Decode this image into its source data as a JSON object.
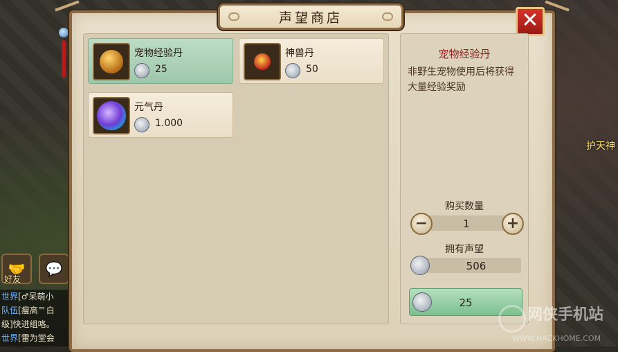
{
  "dialog": {
    "title": "声望商店",
    "close_label": "✕"
  },
  "items": [
    {
      "name": "宠物经验丹",
      "price": "25",
      "selected": true
    },
    {
      "name": "神兽丹",
      "price": "50",
      "selected": false
    },
    {
      "name": "元气丹",
      "price": "1.000",
      "selected": false
    }
  ],
  "detail": {
    "title": "宠物经验丹",
    "description": "非野生宠物使用后将获得大量经验奖励",
    "quantity_label": "购买数量",
    "quantity": "1",
    "minus_label": "−",
    "plus_label": "+",
    "owned_label": "拥有声望",
    "owned_value": "506",
    "buy_price": "25"
  },
  "hud": {
    "friend_label": "好友",
    "protect_label": "护天神",
    "chat": [
      {
        "channel": "世界",
        "text": "[♂呆萌小"
      },
      {
        "channel": "队伍",
        "text": "[瘦高™白"
      },
      {
        "channel": "",
        "text": "级]快进组咯。"
      },
      {
        "channel": "世界",
        "text": "[雷为堂会"
      }
    ]
  },
  "watermark": {
    "main": "网侠手机站",
    "sub": "WWW.HACKHOME.COM"
  },
  "colors": {
    "selected_item": "#9fc8ab",
    "title_red": "#8b1e1e",
    "close_red": "#c12a22",
    "frame": "#8b6a43"
  }
}
